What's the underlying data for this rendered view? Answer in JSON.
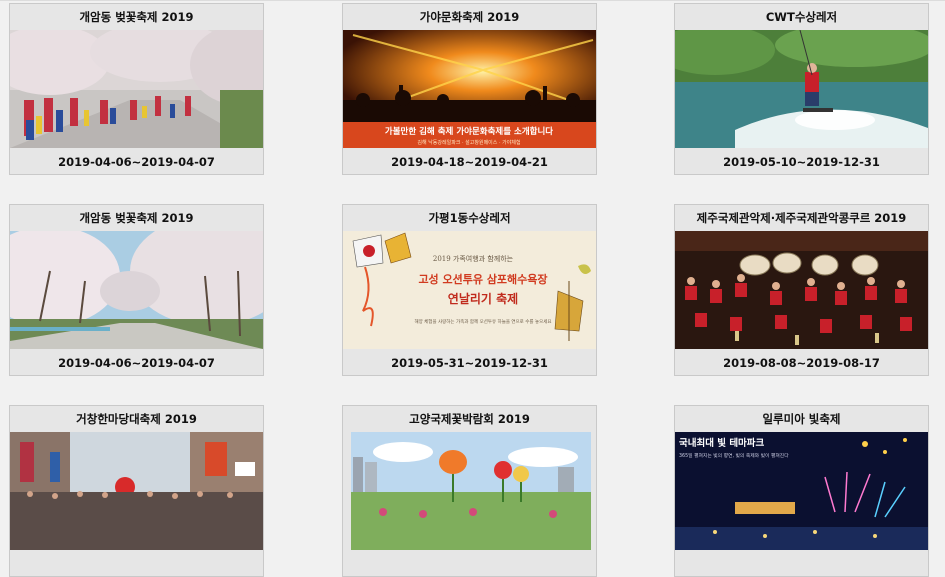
{
  "festivals": [
    {
      "title": "개암동 벚꽃축제 2019",
      "dates": "2019-04-06~2019-04-07",
      "image": "cherry-parade-photo"
    },
    {
      "title": "가야문화축제 2019",
      "dates": "2019-04-18~2019-04-21",
      "image": "concert-banner",
      "banner_text": "가볼만한 김해 축제 가야문화축제를 소개합니다",
      "banner_sub": "김해 낙동강레일파크 · 설고창원메이스 · 가야체험"
    },
    {
      "title": "CWT수상레저",
      "dates": "2019-05-10~2019-12-31",
      "image": "wakeboard-photo"
    },
    {
      "title": "개암동 벚꽃축제 2019",
      "dates": "2019-04-06~2019-04-07",
      "image": "cherry-road-photo"
    },
    {
      "title": "가평1동수상레저",
      "dates": "2019-05-31~2019-12-31",
      "image": "kite-festival-poster",
      "poster_top": "2019 가족여행과 함께하는",
      "poster_main": "고성 오션투유 삼포해수욕장",
      "poster_sub": "연날리기 축제",
      "poster_note": "해양 체험을 사랑하는 가족과 함께 오션투유 하늘을 연으로 수를 놓으세요"
    },
    {
      "title": "제주국제관악제·제주국제관악콩쿠르 2019",
      "dates": "2019-08-08~2019-08-17",
      "image": "brass-band-photo"
    },
    {
      "title": "거창한마당대축제 2019",
      "dates": "",
      "image": "street-festival-photo"
    },
    {
      "title": "고양국제꽃박람회 2019",
      "dates": "",
      "image": "flower-expo-photo"
    },
    {
      "title": "일루미아 빛축제",
      "dates": "",
      "image": "light-park-banner",
      "banner_top": "국내최대 빛 테마파크",
      "banner_sub": "365일 펼쳐지는 빛의 향연, 빛의 축제와 빛이 펼쳐진다"
    }
  ],
  "colors": {
    "page_bg": "#f1f1f1",
    "card_bg": "#e6e6e6",
    "card_border": "#c9c9c9"
  }
}
